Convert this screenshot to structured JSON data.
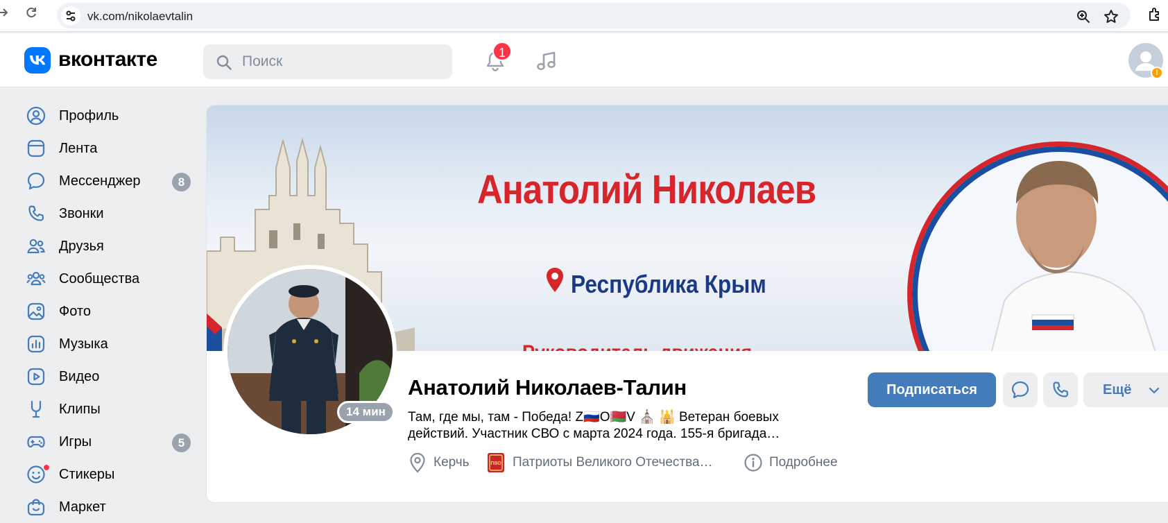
{
  "browser": {
    "url": "vk.com/nikolaevtalin"
  },
  "header": {
    "logo_text": "вконтакте",
    "search_placeholder": "Поиск",
    "notification_count": "1",
    "avatar_warning": "!"
  },
  "sidebar": {
    "items": [
      {
        "label": "Профиль",
        "icon": "user-circle-icon"
      },
      {
        "label": "Лента",
        "icon": "feed-icon"
      },
      {
        "label": "Мессенджер",
        "icon": "message-icon",
        "count": "8"
      },
      {
        "label": "Звонки",
        "icon": "phone-icon"
      },
      {
        "label": "Друзья",
        "icon": "friends-icon"
      },
      {
        "label": "Сообщества",
        "icon": "communities-icon"
      },
      {
        "label": "Фото",
        "icon": "photo-icon"
      },
      {
        "label": "Музыка",
        "icon": "music-icon"
      },
      {
        "label": "Видео",
        "icon": "video-icon"
      },
      {
        "label": "Клипы",
        "icon": "clips-icon"
      },
      {
        "label": "Игры",
        "icon": "games-icon",
        "count": "5"
      },
      {
        "label": "Стикеры",
        "icon": "stickers-icon"
      },
      {
        "label": "Маркет",
        "icon": "market-icon"
      }
    ]
  },
  "cover": {
    "title": "Анатолий Николаев",
    "location": "Республика Крым",
    "cut_text": "Руководитель движения"
  },
  "profile": {
    "name": "Анатолий Николаев-Талин",
    "last_seen": "14 мин",
    "status_line1": "Там, где мы, там - Победа! Z🇷🇺O🇧🇾V ⛪ 🕌 Ветеран боевых",
    "status_line2": "действий. Участник СВО с марта 2024 года. 155-я бригада…",
    "city": "Керчь",
    "community_badge": "ПВО",
    "community": "Патриоты Великого Отечества…",
    "details": "Подробнее"
  },
  "actions": {
    "subscribe": "Подписаться",
    "more": "Ещё"
  },
  "colors": {
    "accent": "#447bba",
    "brand": "#0077ff",
    "badge_red": "#ff3347",
    "counter_gray": "#99a2ad",
    "cover_red": "#d7262b",
    "cover_blue": "#1a3a86"
  }
}
